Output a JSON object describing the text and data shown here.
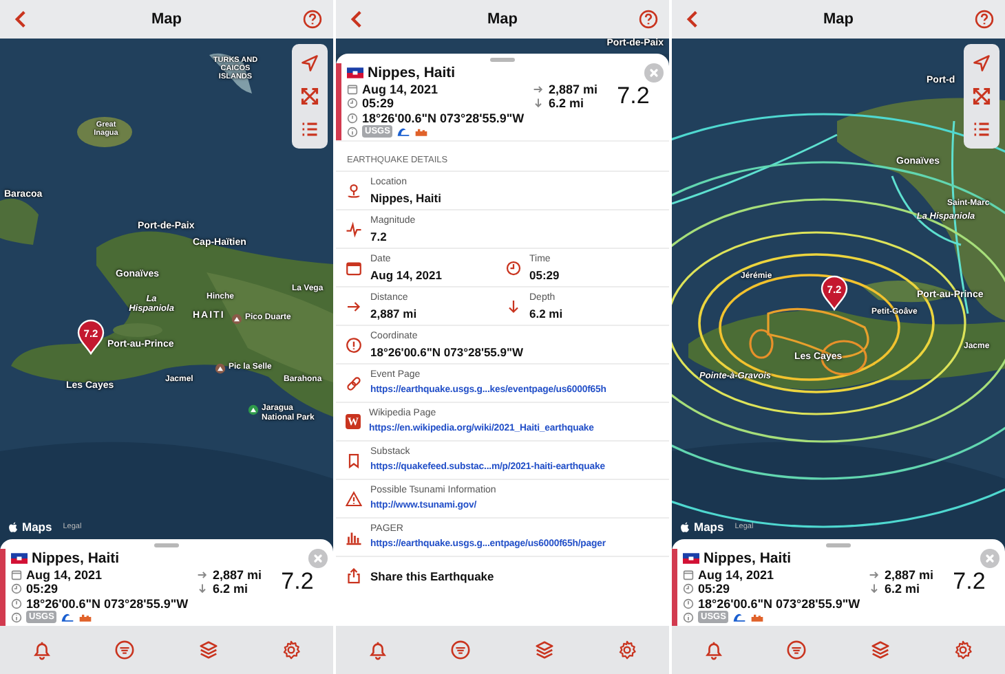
{
  "screens": [
    {
      "kind": "map",
      "title": "Map",
      "contours": false,
      "map_labels": [
        {
          "text": "TURKS AND CAICOS ISLANDS",
          "kind": "region"
        },
        {
          "text": "Great Inagua",
          "kind": "region"
        },
        {
          "text": "Baracoa",
          "kind": "city"
        },
        {
          "text": "Port-de-Paix",
          "kind": "city"
        },
        {
          "text": "Cap-Haïtien",
          "kind": "city"
        },
        {
          "text": "Gonaïves",
          "kind": "city"
        },
        {
          "text": "Hinche",
          "kind": "small"
        },
        {
          "text": "La Hispaniola",
          "kind": "water"
        },
        {
          "text": "HAITI",
          "kind": "country"
        },
        {
          "text": "Pico Duarte",
          "kind": "peak"
        },
        {
          "text": "La Vega",
          "kind": "small"
        },
        {
          "text": "Port-au-Prince",
          "kind": "city"
        },
        {
          "text": "Pic la Selle",
          "kind": "peak"
        },
        {
          "text": "Les Cayes",
          "kind": "city"
        },
        {
          "text": "Jacmel",
          "kind": "small"
        },
        {
          "text": "Barahona",
          "kind": "small"
        },
        {
          "text": "Jaragua National Park",
          "kind": "park"
        }
      ],
      "marker": "7.2",
      "map_logo": "Maps",
      "legal": "Legal",
      "summary": {
        "place": "Nippes, Haiti",
        "date": "Aug 14, 2021",
        "time": "05:29",
        "coordinate": "18°26'00.6\"N 073°28'55.9\"W",
        "distance": "2,887 mi",
        "depth": "6.2 mi",
        "magnitude": "7.2",
        "source": "USGS"
      }
    },
    {
      "kind": "details",
      "title": "Map",
      "map_labels": [
        {
          "text": "Port-de-Paix",
          "kind": "city"
        }
      ],
      "summary": {
        "place": "Nippes, Haiti",
        "date": "Aug 14, 2021",
        "time": "05:29",
        "coordinate": "18°26'00.6\"N 073°28'55.9\"W",
        "distance": "2,887 mi",
        "depth": "6.2 mi",
        "magnitude": "7.2",
        "source": "USGS"
      },
      "section_heading": "EARTHQUAKE DETAILS",
      "rows": [
        {
          "kind": "location",
          "label": "Location",
          "value": "Nippes, Haiti"
        },
        {
          "kind": "magnitude",
          "label": "Magnitude",
          "value": "7.2"
        },
        {
          "kind": "pair",
          "cells": [
            {
              "kind": "date",
              "label": "Date",
              "value": "Aug 14, 2021"
            },
            {
              "kind": "time",
              "label": "Time",
              "value": "05:29"
            }
          ]
        },
        {
          "kind": "pair",
          "cells": [
            {
              "kind": "distance",
              "label": "Distance",
              "value": "2,887 mi"
            },
            {
              "kind": "depth",
              "label": "Depth",
              "value": "6.2 mi"
            }
          ]
        },
        {
          "kind": "coordinate",
          "label": "Coordinate",
          "value": "18°26'00.6\"N 073°28'55.9\"W"
        },
        {
          "kind": "event",
          "label": "Event Page",
          "value": "https://earthquake.usgs.g...kes/eventpage/us6000f65h"
        },
        {
          "kind": "wikipedia",
          "label": "Wikipedia Page",
          "value": "https://en.wikipedia.org/wiki/2021_Haiti_earthquake",
          "icon_text": "W"
        },
        {
          "kind": "substack",
          "label": "Substack",
          "value": "https://quakefeed.substac...m/p/2021-haiti-earthquake"
        },
        {
          "kind": "tsunami",
          "label": "Possible Tsunami Information",
          "value": "http://www.tsunami.gov/"
        },
        {
          "kind": "pager",
          "label": "PAGER",
          "value": "https://earthquake.usgs.g...entpage/us6000f65h/pager"
        },
        {
          "kind": "share",
          "label": "Share this Earthquake"
        }
      ]
    },
    {
      "kind": "map",
      "title": "Map",
      "contours": true,
      "map_labels": [
        {
          "text": "Port-d",
          "kind": "city"
        },
        {
          "text": "Gonaïves",
          "kind": "city"
        },
        {
          "text": "Saint-Marc",
          "kind": "small"
        },
        {
          "text": "La Hispaniola",
          "kind": "water"
        },
        {
          "text": "Jérémie",
          "kind": "small"
        },
        {
          "text": "Port-au-Prince",
          "kind": "city"
        },
        {
          "text": "Petit-Goâve",
          "kind": "small"
        },
        {
          "text": "Les Cayes",
          "kind": "city"
        },
        {
          "text": "Pointe-à-Gravois",
          "kind": "water"
        },
        {
          "text": "Jacme",
          "kind": "small"
        }
      ],
      "marker": "7.2",
      "map_logo": "Maps",
      "legal": "Legal",
      "summary": {
        "place": "Nippes, Haiti",
        "date": "Aug 14, 2021",
        "time": "05:29",
        "coordinate": "18°26'00.6\"N 073°28'55.9\"W",
        "distance": "2,887 mi",
        "depth": "6.2 mi",
        "magnitude": "7.2",
        "source": "USGS"
      }
    }
  ]
}
